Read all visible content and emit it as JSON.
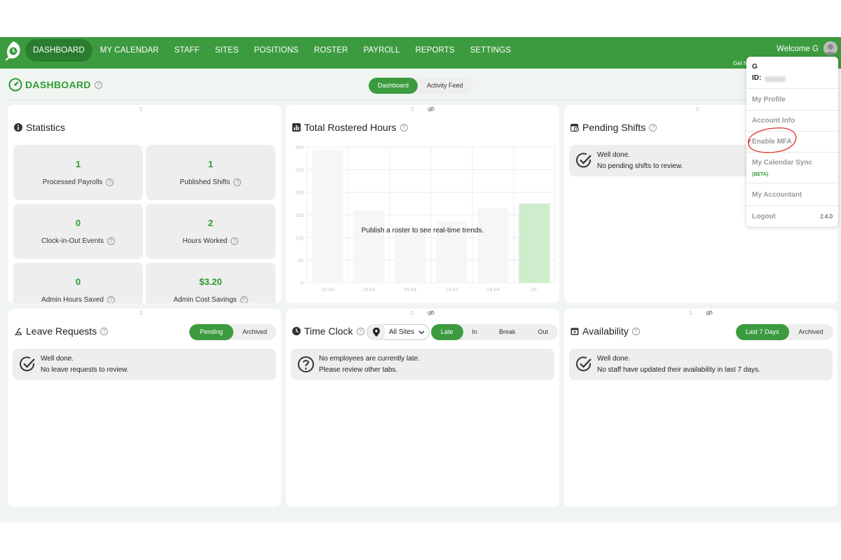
{
  "nav": {
    "items": [
      {
        "label": "DASHBOARD",
        "active": true
      },
      {
        "label": "MY CALENDAR",
        "active": false
      },
      {
        "label": "STAFF",
        "active": false
      },
      {
        "label": "SITES",
        "active": false
      },
      {
        "label": "POSITIONS",
        "active": false
      },
      {
        "label": "ROSTER",
        "active": false
      },
      {
        "label": "PAYROLL",
        "active": false
      },
      {
        "label": "REPORTS",
        "active": false
      },
      {
        "label": "SETTINGS",
        "active": false
      }
    ],
    "welcome": "Welcome G",
    "get_help": "Get h"
  },
  "header": {
    "title": "DASHBOARD",
    "toggle": [
      "Dashboard",
      "Activity Feed"
    ],
    "toggle_active": "Dashboard"
  },
  "statistics": {
    "title": "Statistics",
    "tiles": [
      {
        "value": "1",
        "label": "Processed Payrolls"
      },
      {
        "value": "1",
        "label": "Published Shifts"
      },
      {
        "value": "0",
        "label": "Clock-in-Out Events"
      },
      {
        "value": "2",
        "label": "Hours Worked"
      },
      {
        "value": "0",
        "label": "Admin Hours Saved"
      },
      {
        "value": "$3.20",
        "label": "Admin Cost Savings"
      }
    ]
  },
  "rostered": {
    "title": "Total Rostered Hours",
    "overlay": "Publish a roster to see real-time trends."
  },
  "chart_data": {
    "type": "bar",
    "categories": [
      "22-03",
      "29-03",
      "05-04",
      "12-04",
      "19-04",
      "26-"
    ],
    "values": [
      295,
      160,
      125,
      135,
      165,
      175
    ],
    "highlight_index": 5,
    "yticks": [
      "0",
      "50",
      "100",
      "150",
      "200",
      "250",
      "300"
    ],
    "ylim": [
      0,
      300
    ],
    "grid": true,
    "colors": {
      "bar": "#f6f6f6",
      "highlight": "#cfeccd",
      "grid": "#ececec",
      "tick": "#c4c4c4"
    }
  },
  "pending_shifts": {
    "title": "Pending Shifts",
    "line1": "Well done.",
    "line2": "No pending shifts to review."
  },
  "leave": {
    "title": "Leave Requests",
    "tabs": [
      "Pending",
      "Archived"
    ],
    "line1": "Well done.",
    "line2": "No leave requests to review."
  },
  "timeclock": {
    "title": "Time Clock",
    "sites": "All Sites",
    "tabs": [
      "Late",
      "In",
      "Break",
      "Out"
    ],
    "line1": "No employees are currently late.",
    "line2": "Please review other tabs."
  },
  "availability": {
    "title": "Availability",
    "tabs": [
      "Last 7 Days",
      "Archived"
    ],
    "line1": "Well done.",
    "line2": "No staff have updated their availability in last 7 days."
  },
  "dropdown": {
    "name": "G",
    "id_label": "ID:",
    "items": [
      "My Profile",
      "Account Info",
      "Enable MFA",
      "My Calendar Sync",
      "My Accountant",
      "Logout"
    ],
    "beta": "(BETA)",
    "version": "2.4.0"
  },
  "colors": {
    "brand": "#3c9b3f",
    "accent_text": "#2e9a35",
    "annotation": "#e03030"
  }
}
